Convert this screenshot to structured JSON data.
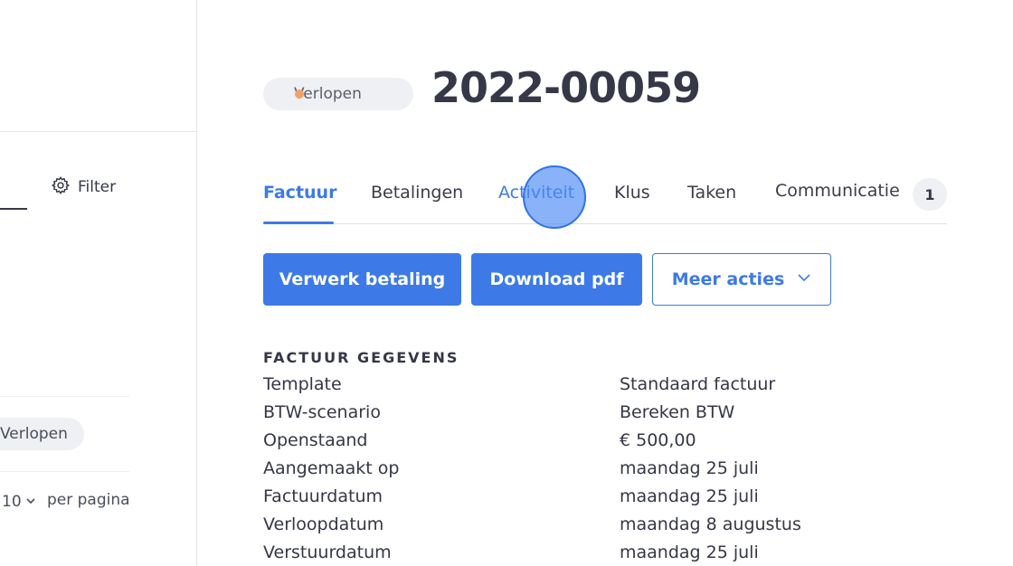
{
  "left_panel": {
    "filter_label": "Filter",
    "list_badge": "Verlopen",
    "pager_value": "10",
    "pager_label": "per pagina"
  },
  "header": {
    "status": "Verlopen",
    "status_color": "#f6a163",
    "title": "2022-00059"
  },
  "tabs": [
    {
      "label": "Factuur",
      "active": true
    },
    {
      "label": "Betalingen"
    },
    {
      "label": "Activiteit"
    },
    {
      "label": "Klus"
    },
    {
      "label": "Taken"
    },
    {
      "label": "Communicatie",
      "count": "1"
    }
  ],
  "actions": {
    "process_payment": "Verwerk betaling",
    "download_pdf": "Download pdf",
    "more_actions": "Meer acties"
  },
  "details": {
    "section_title": "FACTUUR GEGEVENS",
    "rows": [
      {
        "label": "Template",
        "value": "Standaard factuur"
      },
      {
        "label": "BTW-scenario",
        "value": "Bereken BTW"
      },
      {
        "label": "Openstaand",
        "value": "€ 500,00"
      },
      {
        "label": "Aangemaakt op",
        "value": "maandag 25 juli"
      },
      {
        "label": "Factuurdatum",
        "value": "maandag 25 juli"
      },
      {
        "label": "Verloopdatum",
        "value": "maandag 8 augustus"
      },
      {
        "label": "Verstuurdatum",
        "value": "maandag 25 juli"
      }
    ]
  },
  "colors": {
    "accent": "#3d7ae8",
    "text": "#353747",
    "badge_bg": "#eef0f4"
  }
}
